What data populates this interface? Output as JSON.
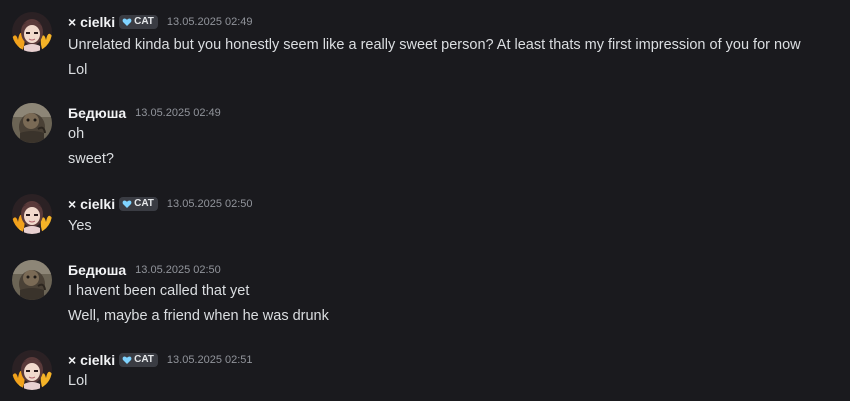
{
  "messages": [
    {
      "author": "× cielki",
      "tag": "CAT",
      "timestamp": "13.05.2025 02:49",
      "lines": [
        "Unrelated kinda but you honestly seem like a really sweet person? At least thats my first impression of you for now",
        "Lol"
      ]
    },
    {
      "author": "Бедюша",
      "timestamp": "13.05.2025 02:49",
      "lines": [
        "oh",
        "sweet?"
      ]
    },
    {
      "author": "× cielki",
      "tag": "CAT",
      "timestamp": "13.05.2025 02:50",
      "lines": [
        "Yes"
      ]
    },
    {
      "author": "Бедюша",
      "timestamp": "13.05.2025 02:50",
      "lines": [
        "I havent been called that yet",
        "Well, maybe a friend when he was drunk"
      ]
    },
    {
      "author": "× cielki",
      "tag": "CAT",
      "timestamp": "13.05.2025 02:51",
      "lines": [
        "Lol"
      ]
    }
  ],
  "colors": {
    "background": "#1a1a1e",
    "text": "#dbdee1",
    "username": "#f2f3f5",
    "timestamp": "#91949b",
    "badge_bg": "#3a3c43",
    "heart": "#7fd3ff"
  },
  "icons": {
    "tag_icon": "heart-icon"
  }
}
